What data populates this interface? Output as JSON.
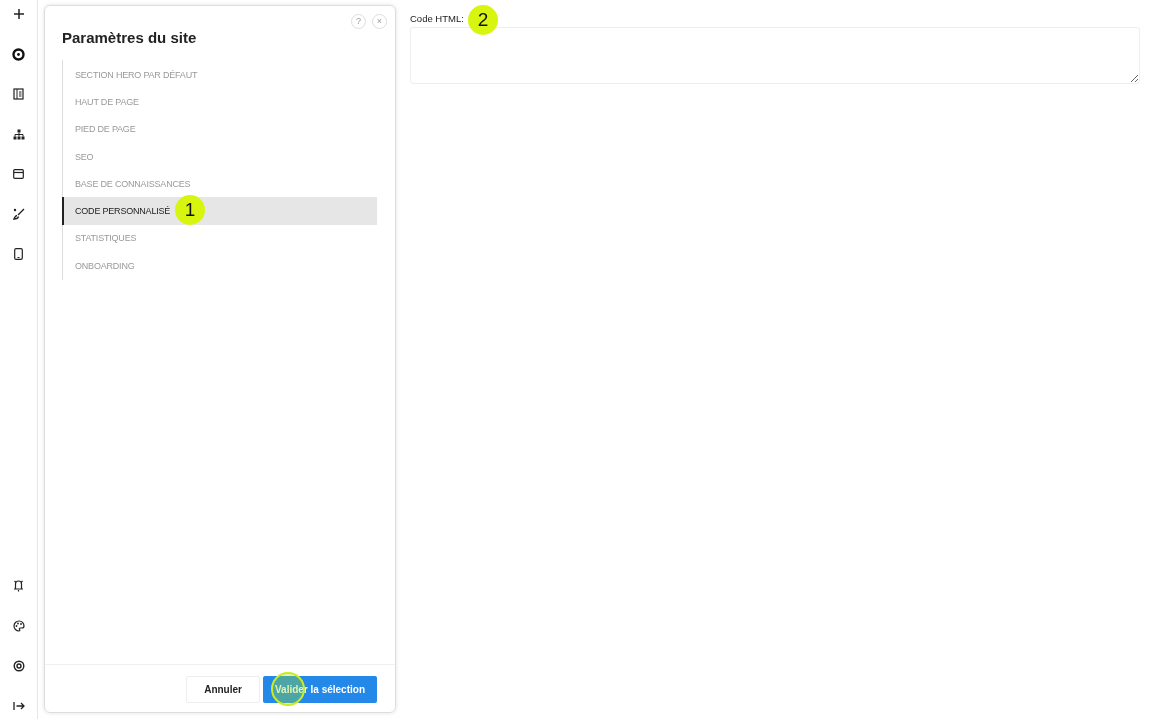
{
  "rail": {
    "top": [
      {
        "kind": "plus"
      },
      {
        "kind": "logo"
      },
      {
        "kind": "book"
      },
      {
        "kind": "sitemap"
      },
      {
        "kind": "window"
      },
      {
        "kind": "brush"
      },
      {
        "kind": "phone"
      }
    ],
    "bottom": [
      {
        "kind": "bell"
      },
      {
        "kind": "palette"
      },
      {
        "kind": "gear"
      },
      {
        "kind": "logout"
      }
    ]
  },
  "panel": {
    "title": "Paramètres du site",
    "help": "?",
    "close": "×",
    "items": [
      {
        "label": "SECTION HERO PAR DÉFAUT",
        "selected": false
      },
      {
        "label": "HAUT DE PAGE",
        "selected": false
      },
      {
        "label": "PIED DE PAGE",
        "selected": false
      },
      {
        "label": "SEO",
        "selected": false
      },
      {
        "label": "BASE DE CONNAISSANCES",
        "selected": false
      },
      {
        "label": "CODE PERSONNALISÉ",
        "selected": true,
        "marker": "1"
      },
      {
        "label": "STATISTIQUES",
        "selected": false
      },
      {
        "label": "ONBOARDING",
        "selected": false
      }
    ],
    "buttons": [
      {
        "label": "Annuler",
        "kind": "secondary",
        "highlighted": false
      },
      {
        "label": "Valider la sélection",
        "kind": "primary",
        "highlighted": true
      }
    ]
  },
  "field": {
    "label": "Code HTML:",
    "marker": "2"
  }
}
